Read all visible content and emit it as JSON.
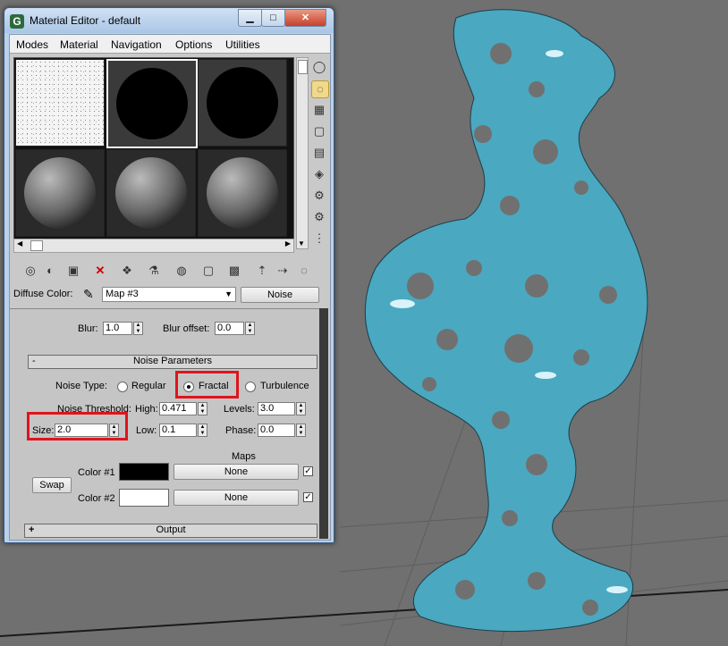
{
  "window": {
    "title": "Material Editor - default",
    "app_icon_glyph": "G",
    "minimize_glyph": "▁",
    "maximize_glyph": "□",
    "close_glyph": "✕"
  },
  "menubar": {
    "items": [
      "Modes",
      "Material",
      "Navigation",
      "Options",
      "Utilities"
    ]
  },
  "diffuse": {
    "label": "Diffuse Color:",
    "map_name": "Map #3",
    "map_type_button": "Noise"
  },
  "top_row": {
    "blur_label": "Blur:",
    "blur_value": "1.0",
    "blur_offset_label": "Blur offset:",
    "blur_offset_value": "0.0"
  },
  "noise_parameters": {
    "rollout_toggle": "-",
    "title": "Noise Parameters",
    "noise_type_label": "Noise Type:",
    "types": [
      "Regular",
      "Fractal",
      "Turbulence"
    ],
    "selected_type": "Fractal",
    "noise_threshold_label": "Noise Threshold:",
    "high_label": "High:",
    "high_value": "0.471",
    "levels_label": "Levels:",
    "levels_value": "3.0",
    "size_label": "Size:",
    "size_value": "2.0",
    "low_label": "Low:",
    "low_value": "0.1",
    "phase_label": "Phase:",
    "phase_value": "0.0",
    "maps_label": "Maps",
    "swap_label": "Swap",
    "color1_label": "Color #1",
    "color1_hex": "#000000",
    "color1_map": "None",
    "color2_label": "Color #2",
    "color2_hex": "#ffffff",
    "color2_map": "None",
    "check_glyph": "✓"
  },
  "output_rollout": {
    "toggle": "+",
    "title": "Output"
  },
  "colors": {
    "viewport_bg": "#707070",
    "mesh": "#4aa8c0",
    "highlight_red": "#e0141c"
  }
}
